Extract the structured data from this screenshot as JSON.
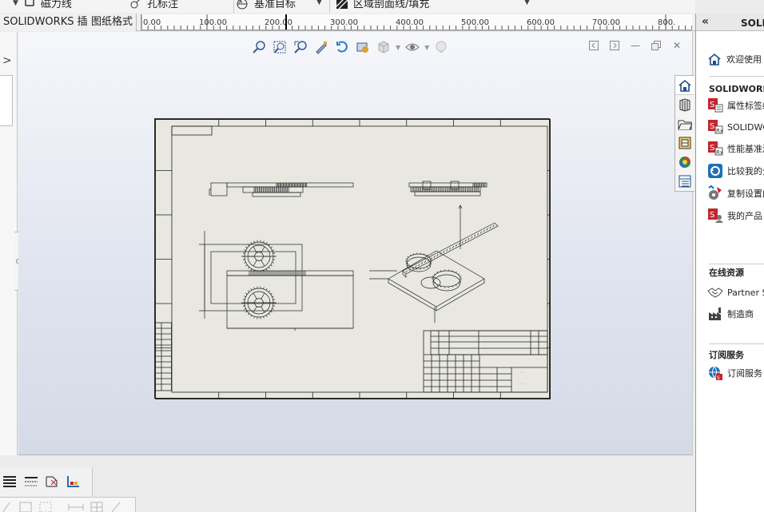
{
  "toolbar": {
    "items": [
      {
        "label": "磁力线",
        "icon": "magnet-line-icon"
      },
      {
        "label": "孔标注",
        "icon": "hole-callout-icon"
      },
      {
        "label": "基准目标",
        "icon": "datum-target-icon"
      },
      {
        "label": "区域剖面线/填充",
        "icon": "hatch-fill-icon"
      }
    ]
  },
  "tabs": [
    {
      "label": "SOLIDWORKS 插件"
    },
    {
      "label": "图纸格式"
    }
  ],
  "ruler": {
    "labels": [
      "0.00",
      "100.00",
      "200.00",
      "300.00",
      "400.00",
      "500.00",
      "600.00",
      "700.00",
      "800."
    ]
  },
  "task_pane": {
    "title": "SOLIDWORKS 资源",
    "welcome": "欢迎使用",
    "sections": [
      {
        "title": "SOLIDWORKS 工具",
        "items": [
          {
            "label": "属性标签编制程序",
            "icon": "property-tab-builder-icon"
          },
          {
            "label": "SOLIDWORKS Rx",
            "icon": "solidworks-rx-icon"
          },
          {
            "label": "性能基准测试",
            "icon": "benchmark-icon"
          },
          {
            "label": "比较我的分数",
            "icon": "compare-score-icon"
          },
          {
            "label": "复制设置向导",
            "icon": "copy-settings-icon"
          },
          {
            "label": "我的产品",
            "icon": "my-products-icon"
          }
        ]
      },
      {
        "title": "在线资源",
        "items": [
          {
            "label": "Partner Solutions",
            "icon": "handshake-icon"
          },
          {
            "label": "制造商",
            "icon": "factory-icon"
          }
        ]
      },
      {
        "title": "订阅服务",
        "items": [
          {
            "label": "订阅服务",
            "icon": "subscription-globe-icon"
          }
        ]
      }
    ]
  },
  "colors": {
    "accent_red": "#c8232c",
    "accent_blue": "#1e6fb8",
    "sheet": "#e8e8e0"
  }
}
